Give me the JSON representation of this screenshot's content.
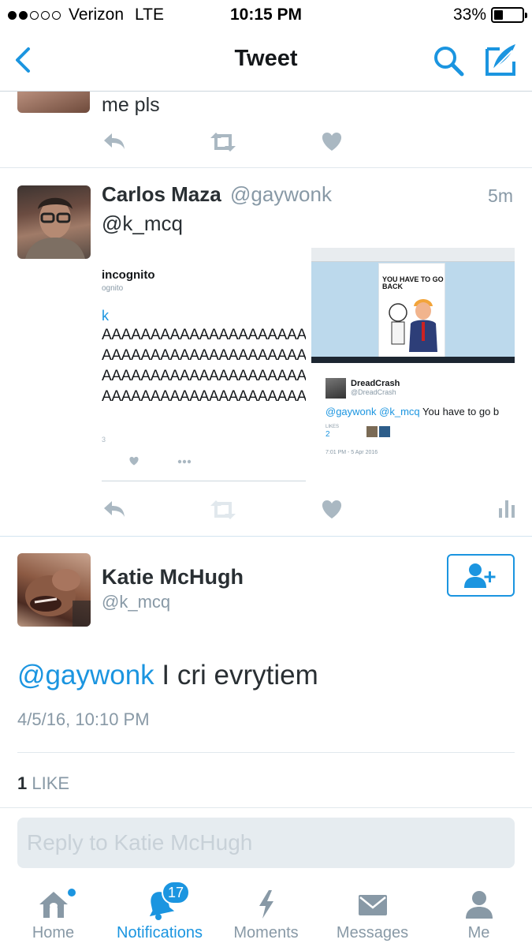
{
  "status_bar": {
    "carrier": "Verizon",
    "network": "LTE",
    "time": "10:15 PM",
    "battery": "33%",
    "battery_level": 0.33
  },
  "nav": {
    "title": "Tweet"
  },
  "previous_tweet": {
    "text_tail": "me pls"
  },
  "quoted_reply": {
    "name": "Carlos Maza",
    "handle": "@gaywonk",
    "time": "5m",
    "text": "@k_mcq",
    "left_image": {
      "title": "incognito",
      "subtitle": "ognito",
      "link": "k",
      "lines": [
        "AAAAAAAAAAAAAAAAAAAAAAA",
        "AAAAAAAAAAAAAAAAAAAAAAA",
        "AAAAAAAAAAAAAAAAAAAAAAA",
        "AAAAAAAAAAAAAAAAAAAAAAA"
      ],
      "count": "3"
    },
    "right_image": {
      "meme_text": "YOU HAVE TO GO BACK",
      "embedded_name": "DreadCrash",
      "embedded_handle": "@DreadCrash",
      "embedded_mention1": "@gaywonk",
      "embedded_mention2": "@k_mcq",
      "embedded_text": "You have to go b",
      "likes_label": "LIKES",
      "likes_count": "2",
      "embedded_date": "7:01 PM - 5 Apr 2016"
    }
  },
  "main_tweet": {
    "name": "Katie McHugh",
    "handle": "@k_mcq",
    "mention": "@gaywonk",
    "text": " I cri evrytiem",
    "date": "4/5/16, 10:10 PM",
    "likes_count": "1",
    "likes_label": "LIKE"
  },
  "reply": {
    "placeholder": "Reply to Katie McHugh"
  },
  "tabs": [
    {
      "label": "Home",
      "icon": "home-icon"
    },
    {
      "label": "Notifications",
      "icon": "bell-icon",
      "badge": "17"
    },
    {
      "label": "Moments",
      "icon": "lightning-icon"
    },
    {
      "label": "Messages",
      "icon": "envelope-icon"
    },
    {
      "label": "Me",
      "icon": "person-icon"
    }
  ],
  "colors": {
    "accent": "#1b95e0",
    "muted": "#8899a6",
    "text": "#292f33",
    "divider": "#e1e8ed"
  }
}
